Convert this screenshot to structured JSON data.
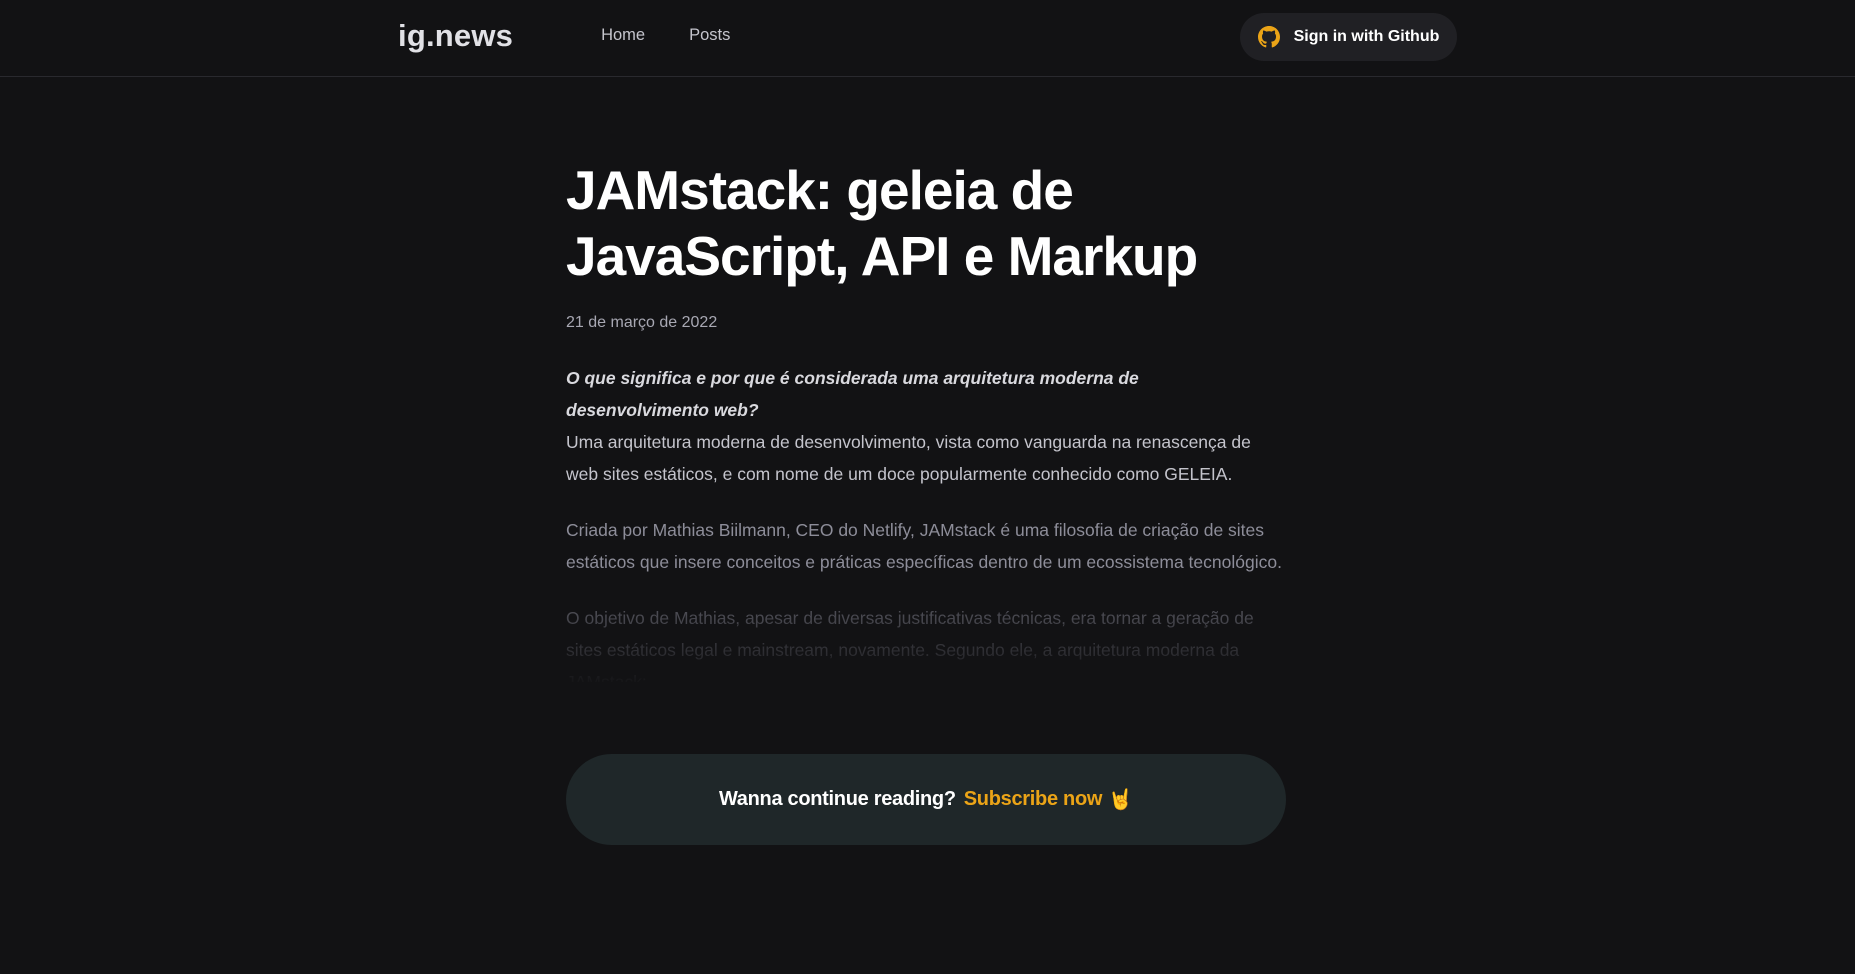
{
  "header": {
    "logo": "ig.news",
    "nav": [
      {
        "label": "Home"
      },
      {
        "label": "Posts"
      }
    ],
    "signin": {
      "label": "Sign in with Github",
      "icon": "github-icon",
      "icon_color": "#eba417"
    }
  },
  "post": {
    "title_line1": "JAMstack: geleia de",
    "title_line2": "JavaScript, API e Markup",
    "date": "21 de março de 2022",
    "lead_question": "O que significa e por que é considerada uma arquitetura moderna de desenvolvimento web?",
    "paragraph1": "Uma arquitetura moderna de desenvolvimento, vista como vanguarda na renascença de web sites estáticos, e com nome de um doce popularmente conhecido como GELEIA.",
    "paragraph2": "Criada por Mathias Biilmann, CEO do Netlify, JAMstack é uma filosofia de criação de sites estáticos que insere conceitos e práticas específicas dentro de um ecossistema tecnológico.",
    "paragraph3": "O objetivo de Mathias, apesar de diversas justificativas técnicas, era tornar a geração de sites estáticos legal e mainstream, novamente. Segundo ele, a arquitetura moderna da JAMstack:"
  },
  "cta": {
    "text": "Wanna continue reading?",
    "link": "Subscribe now",
    "emoji": "🤘",
    "accent": "#eba417"
  }
}
